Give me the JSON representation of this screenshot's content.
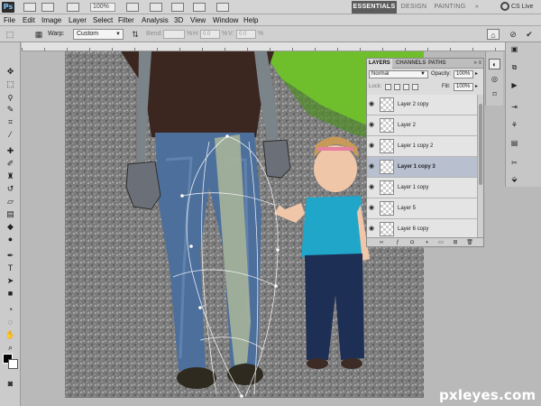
{
  "appbar": {
    "logo": "Ps",
    "zoom": "100%",
    "workspaces": [
      {
        "label": "ESSENTIALS",
        "active": true
      },
      {
        "label": "DESIGN",
        "active": false
      },
      {
        "label": "PAINTING",
        "active": false
      }
    ],
    "more": "»",
    "cs_live": "CS Live",
    "window_controls": [
      "–",
      "□",
      "×"
    ]
  },
  "menu": [
    "File",
    "Edit",
    "Image",
    "Layer",
    "Select",
    "Filter",
    "Analysis",
    "3D",
    "View",
    "Window",
    "Help"
  ],
  "options": {
    "warp_label": "Warp:",
    "warp_value": "Custom",
    "bend_label": "Bend:",
    "bend_value": "",
    "h_label": "H:",
    "h_value": "0.0",
    "v_label": "V:",
    "v_value": "0.0",
    "percent": "%"
  },
  "layers_panel": {
    "tabs": [
      {
        "label": "LAYERS",
        "active": true
      },
      {
        "label": "CHANNELS",
        "active": false
      },
      {
        "label": "PATHS",
        "active": false
      }
    ],
    "blend_mode": "Normal",
    "opacity_label": "Opacity:",
    "opacity_value": "100%",
    "lock_label": "Lock:",
    "fill_label": "Fill:",
    "fill_value": "100%",
    "layers": [
      {
        "name": "Layer 2 copy",
        "selected": false
      },
      {
        "name": "Layer 2",
        "selected": false
      },
      {
        "name": "Layer 1 copy 2",
        "selected": false
      },
      {
        "name": "Layer 1 copy 3",
        "selected": true
      },
      {
        "name": "Layer 1 copy",
        "selected": false
      },
      {
        "name": "Layer 5",
        "selected": false
      },
      {
        "name": "Layer 6 copy",
        "selected": false
      }
    ]
  },
  "watermark": "pxleyes.com",
  "colors": {
    "chrome": "#d4d4d4",
    "workspace_bg": "#b9b9b9",
    "selected_layer": "#b8bfcf",
    "active_workspace": "#5c5c5c"
  }
}
